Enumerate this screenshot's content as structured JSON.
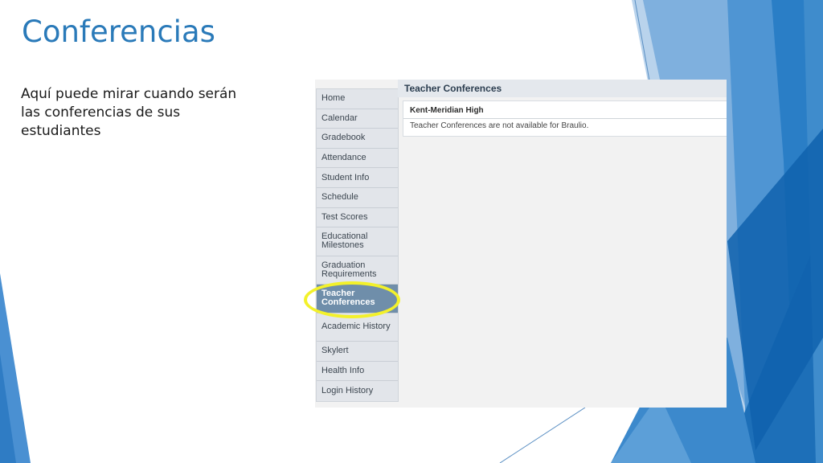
{
  "slide": {
    "title": "Conferencias",
    "body_text": "Aquí puede mirar cuando serán las conferencias de sus estudiantes"
  },
  "screenshot": {
    "nav_items": [
      {
        "label": "Home",
        "active": false
      },
      {
        "label": "Calendar",
        "active": false
      },
      {
        "label": "Gradebook",
        "active": false
      },
      {
        "label": "Attendance",
        "active": false
      },
      {
        "label": "Student Info",
        "active": false
      },
      {
        "label": "Schedule",
        "active": false
      },
      {
        "label": "Test Scores",
        "active": false
      },
      {
        "label": "Educational Milestones",
        "active": false
      },
      {
        "label": "Graduation Requirements",
        "active": false
      },
      {
        "label": "Teacher Conferences",
        "active": true
      },
      {
        "label": "Academic History",
        "active": false
      },
      {
        "label": "Skylert",
        "active": false
      },
      {
        "label": "Health Info",
        "active": false
      },
      {
        "label": "Login History",
        "active": false
      }
    ],
    "page_heading": "Teacher Conferences",
    "school_name": "Kent-Meridian High",
    "message": "Teacher Conferences are not available for Braulio."
  },
  "colors": {
    "title": "#2a7ab9",
    "highlight": "#f3f12a",
    "active_nav": "#6f8eaa",
    "deco_blue": "#1f6fb5"
  }
}
